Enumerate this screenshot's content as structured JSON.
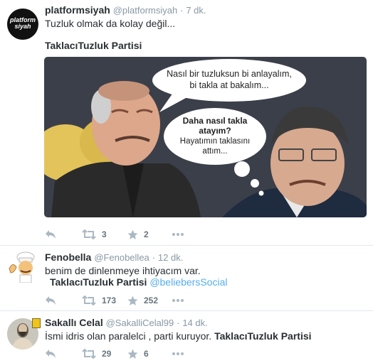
{
  "tweets": [
    {
      "name": "platformsiyah",
      "handle": "@platformsiyah",
      "dot": "·",
      "time": "7 dk.",
      "text": "Tuzluk olmak da kolay değil...",
      "hashtag": "TaklacıTuzluk Partisi",
      "avatar_text": "platform siyah",
      "photo": {
        "bubble1_line1": "Nasıl bir tuzluksun bi anlayalım,",
        "bubble1_line2": "bi takla at bakalım...",
        "bubble2_line1": "Daha nasıl takla",
        "bubble2_line2": "atayım?",
        "bubble2_line3": "Hayatımın taklasını",
        "bubble2_line4": "attım..."
      },
      "retweets": "3",
      "likes": "2"
    },
    {
      "name": "Fenobella",
      "handle": "@Fenobellea",
      "dot": "·",
      "time": "12 dk.",
      "text": "benim de dinlenmeye ihtiyacım var.",
      "hashtag": "TaklacıTuzluk Partisi",
      "mention": "@beliebersSocial",
      "retweets": "173",
      "likes": "252"
    },
    {
      "name": "Sakallı Celal",
      "handle": "@SakalliCelal99",
      "dot": "·",
      "time": "14 dk.",
      "text": "İsmi idris olan paralelci , parti kuruyor.",
      "hashtag": "TaklacıTuzluk Partisi",
      "retweets": "29",
      "likes": "6"
    }
  ],
  "colors": {
    "accent": "#55acee",
    "icon": "#aab8c2",
    "text": "#292f33",
    "muted": "#8899a6"
  }
}
